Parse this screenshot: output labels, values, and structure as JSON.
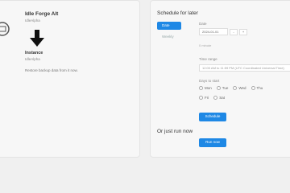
{
  "source": {
    "name": "Idle Forge Alt",
    "sub": "IdleAlpha",
    "icon": "cloud-server-icon"
  },
  "target": {
    "name": "Instance",
    "sub": "IdleAlpha",
    "description": "Restore backup data from it now."
  },
  "schedule": {
    "title": "Schedule for later",
    "tabs": [
      "Date",
      "Weekly"
    ],
    "date_label": "Date",
    "date_value": "2024-01-01",
    "minus_label": "-",
    "plus_label": "+",
    "timezone": "0 minute",
    "time_label": "Time range",
    "time_value": "12:00 AM to 11:59 PM (UTC Coordinated Universal Time)",
    "days_label": "Days to start",
    "days_row1": [
      "Mon",
      "Tue",
      "Wed",
      "Thu"
    ],
    "days_row2": [
      "Fri",
      "Sat"
    ],
    "schedule_button": "Schedule"
  },
  "or_now": {
    "title": "Or just run now",
    "button": "Run now"
  },
  "colors": {
    "accent": "#1e88e5"
  }
}
